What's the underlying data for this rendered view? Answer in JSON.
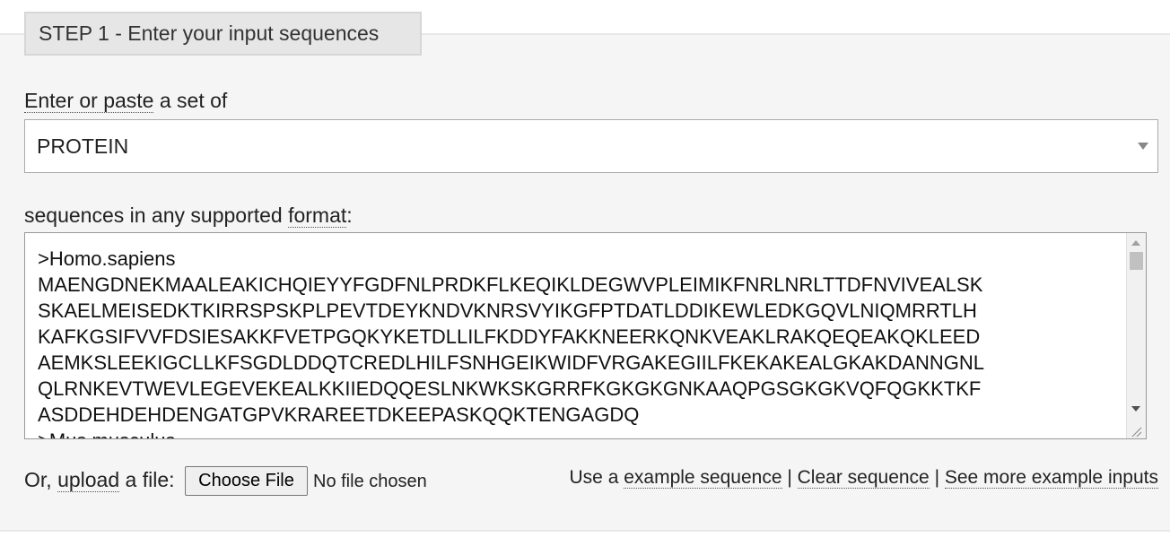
{
  "step": {
    "legend": "STEP 1 - Enter your input sequences"
  },
  "sequence_type": {
    "label_pre": "Enter or paste",
    "label_post": " a set of",
    "selected_value": "PROTEIN"
  },
  "sequences": {
    "label_pre": "sequences in any supported ",
    "label_link": "format",
    "label_post": ":",
    "text": ">Homo.sapiens\nMAENGDNEKMAALEAKICHQIEYYFGDFNLPRDKFLKEQIKLDEGWVPLEIMIKFNRLNRLTTDFNVIVEALSK\nSKAELMEISEDKTKIRRSPSKPLPEVTDEYKNDVKNRSVYIKGFPTDATLDDIKEWLEDKGQVLNIQMRRTLH\nKAFKGSIFVVFDSIESAKKFVETPGQKYKETDLLILFKDDYFAKKNEERKQNKVEAKLRAKQEQEAKQKLEED\nAEMKSLEEKIGCLLKFSGDLDDQTCREDLHILFSNHGEIKWIDFVRGAKEGIILFKEKAKEALGKAKDANNGNL\nQLRNKEVTWEVLEGEVEKEALKKIIEDQQESLNKWKSKGRRFKGKGKGNKAAQPGSGKGKVQFQGKKTKF\nASDDEHDEHDENGATGPVKRAREETDKEEPASKQQKTENGAGDQ\n>Mus.musculus"
  },
  "upload": {
    "label_pre": "Or, ",
    "label_link": "upload",
    "label_post": " a file:",
    "button": "Choose File",
    "status": "No file chosen"
  },
  "links": {
    "pre": "Use a ",
    "example": "example sequence",
    "sep1": " | ",
    "clear": "Clear sequence",
    "sep2": " | ",
    "more": "See more example inputs"
  }
}
